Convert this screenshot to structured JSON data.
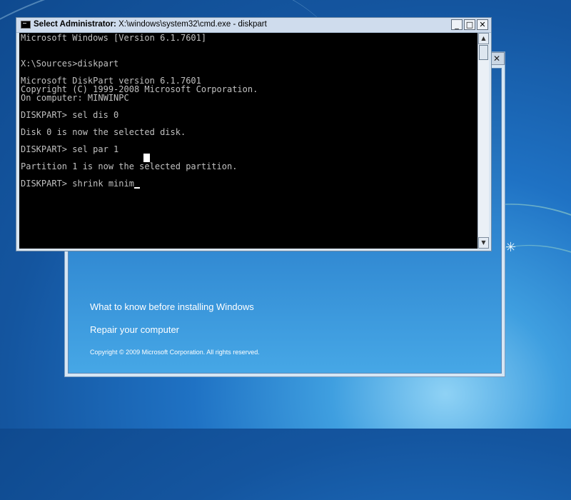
{
  "cmd": {
    "title_prefix": "Select Administrator: ",
    "title_path": "X:\\windows\\system32\\cmd.exe - diskpart",
    "controls": {
      "minimize": "_",
      "maximize": "□",
      "close": "✕"
    },
    "lines": [
      "Microsoft Windows [Version 6.1.7601]",
      "",
      "X:\\Sources>diskpart",
      "",
      "Microsoft DiskPart version 6.1.7601",
      "Copyright (C) 1999-2008 Microsoft Corporation.",
      "On computer: MINWINPC",
      "",
      "DISKPART> sel dis 0",
      "",
      "Disk 0 is now the selected disk.",
      "",
      "DISKPART> sel par 1",
      "",
      "Partition 1 is now the selected partition.",
      "",
      "DISKPART> shrink minim"
    ],
    "scroll": {
      "up": "▲",
      "down": "▼"
    }
  },
  "setup": {
    "close": "✕",
    "what_to_know": "What to know before installing Windows",
    "repair": "Repair your computer",
    "copyright": "Copyright © 2009 Microsoft Corporation. All rights reserved."
  },
  "desktop": {
    "flare_glyph": "✳"
  }
}
